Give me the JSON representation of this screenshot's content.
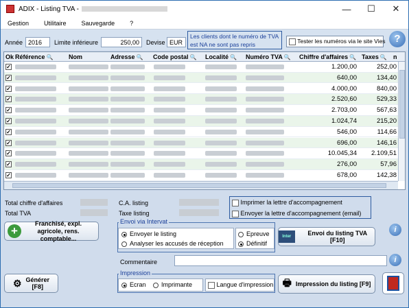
{
  "window": {
    "title": "ADIX - Listing TVA -"
  },
  "menu": [
    "Gestion",
    "Utilitaire",
    "Sauvegarde",
    "?"
  ],
  "filters": {
    "annee_label": "Année",
    "annee_value": "2016",
    "limite_label": "Limite inférieure",
    "limite_value": "250,00",
    "devise_label": "Devise",
    "devise_value": "EUR",
    "note": "Les clients dont le numéro de TVA est NA ne sont pas repris",
    "test_vies": "Tester les numéros via le site Vies"
  },
  "table": {
    "headers": [
      "Ok",
      "Référence",
      "Nom",
      "Adresse",
      "Code postal",
      "Localité",
      "Numéro TVA",
      "Chiffre d'affaires",
      "Taxes",
      "n"
    ],
    "rows": [
      {
        "ca": "1.200,00",
        "tax": "252,00"
      },
      {
        "ca": "640,00",
        "tax": "134,40"
      },
      {
        "ca": "4.000,00",
        "tax": "840,00"
      },
      {
        "ca": "2.520,60",
        "tax": "529,33"
      },
      {
        "ca": "2.703,00",
        "tax": "567,63"
      },
      {
        "ca": "1.024,74",
        "tax": "215,20"
      },
      {
        "ca": "546,00",
        "tax": "114,66"
      },
      {
        "ca": "696,00",
        "tax": "146,16"
      },
      {
        "ca": "10.045,34",
        "tax": "2.109,51"
      },
      {
        "ca": "276,00",
        "tax": "57,96"
      },
      {
        "ca": "678,00",
        "tax": "142,38"
      }
    ]
  },
  "totals": {
    "ca_label": "Total chiffre d'affaires",
    "tva_label": "Total TVA",
    "ca_listing_label": "C.A. listing",
    "tax_listing_label": "Taxe listing"
  },
  "print_options": {
    "lettre": "Imprimer la lettre d'accompagnement",
    "lettre_email": "Envoyer la lettre d'accompagnement (email)"
  },
  "buttons": {
    "franchise": "Franchisé, expl. agricole, rens. comptable...",
    "generer": "Générer\n[F8]",
    "envoi": "Envoi du listing TVA  [F10]",
    "impression": "Impression du listing  [F9]"
  },
  "intervat": {
    "title": "Envoi via Intervat",
    "envoyer": "Envoyer le listing",
    "analyser": "Analyser les accusés de réception",
    "epreuve": "Epreuve",
    "definitif": "Définitif",
    "commentaire": "Commentaire"
  },
  "impression": {
    "title": "Impression",
    "ecran": "Ecran",
    "imprimante": "Imprimante",
    "langue": "Langue d'impression"
  }
}
